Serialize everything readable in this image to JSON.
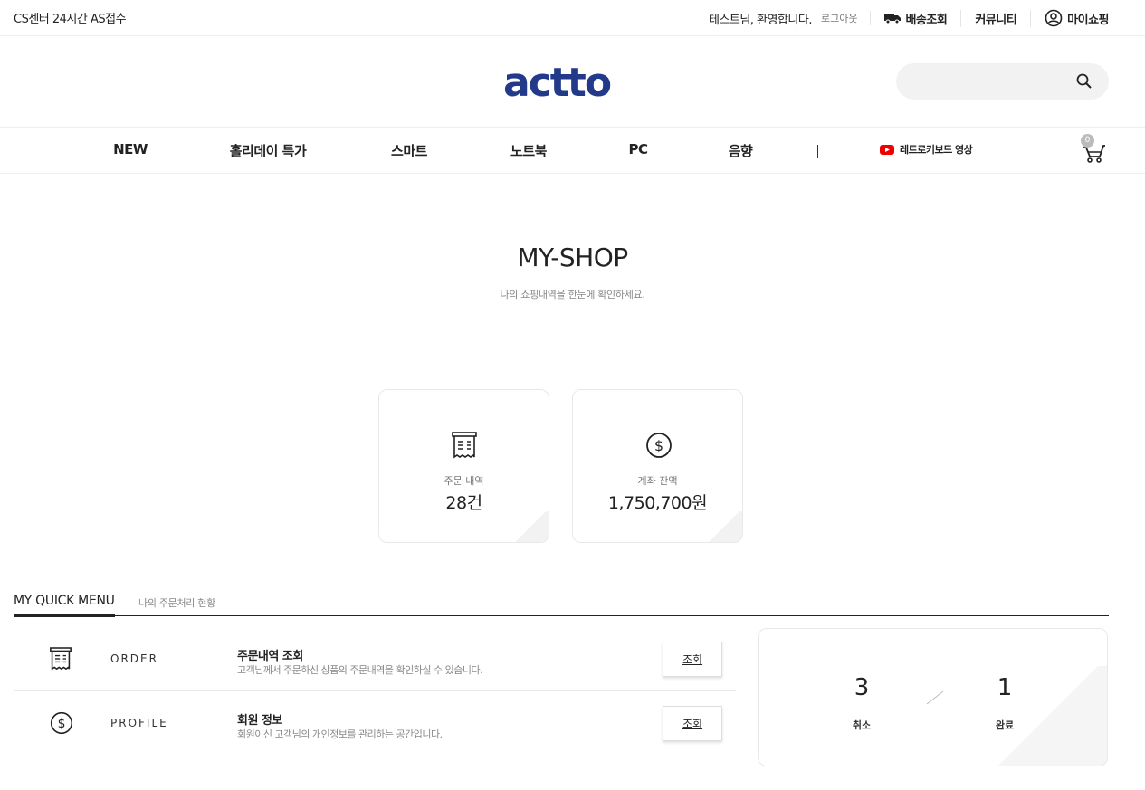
{
  "topbar": {
    "cs_text": "CS센터 24시간 AS접수",
    "welcome": "테스트님, 환영합니다.",
    "logout": "로그아웃",
    "delivery": "배송조회",
    "community": "커뮤니티",
    "myshopping": "마이쇼핑"
  },
  "header": {
    "logo_text": "actto",
    "brand_color": "#233a8a",
    "search_placeholder": ""
  },
  "nav": {
    "items": [
      "NEW",
      "홀리데이 특가",
      "스마트",
      "노트북",
      "PC",
      "음향"
    ],
    "video_link": "레트로키보드 영상",
    "cart_count": "0"
  },
  "page": {
    "title": "MY-SHOP",
    "subtitle": "나의 쇼핑내역을 한눈에 확인하세요."
  },
  "cards": [
    {
      "icon": "receipt-icon",
      "label": "주문 내역",
      "value": "28건"
    },
    {
      "icon": "dollar-circle-icon",
      "label": "계좌 잔액",
      "value": "1,750,700원"
    }
  ],
  "quick_menu": {
    "title": "MY QUICK MENU",
    "subtitle": "나의 주문처리 현황",
    "rows": [
      {
        "icon": "receipt-icon",
        "key": "ORDER",
        "name": "주문내역 조회",
        "desc": "고객님께서 주문하신 상품의 주문내역을 확인하실 수 있습니다.",
        "button": "조회"
      },
      {
        "icon": "dollar-circle-icon",
        "key": "PROFILE",
        "name": "회원 정보",
        "desc": "회원이신 고객님의 개인정보를 관리하는 공간입니다.",
        "button": "조회"
      }
    ]
  },
  "order_status": {
    "cancel_count": "3",
    "cancel_label": "취소",
    "complete_count": "1",
    "complete_label": "완료"
  }
}
